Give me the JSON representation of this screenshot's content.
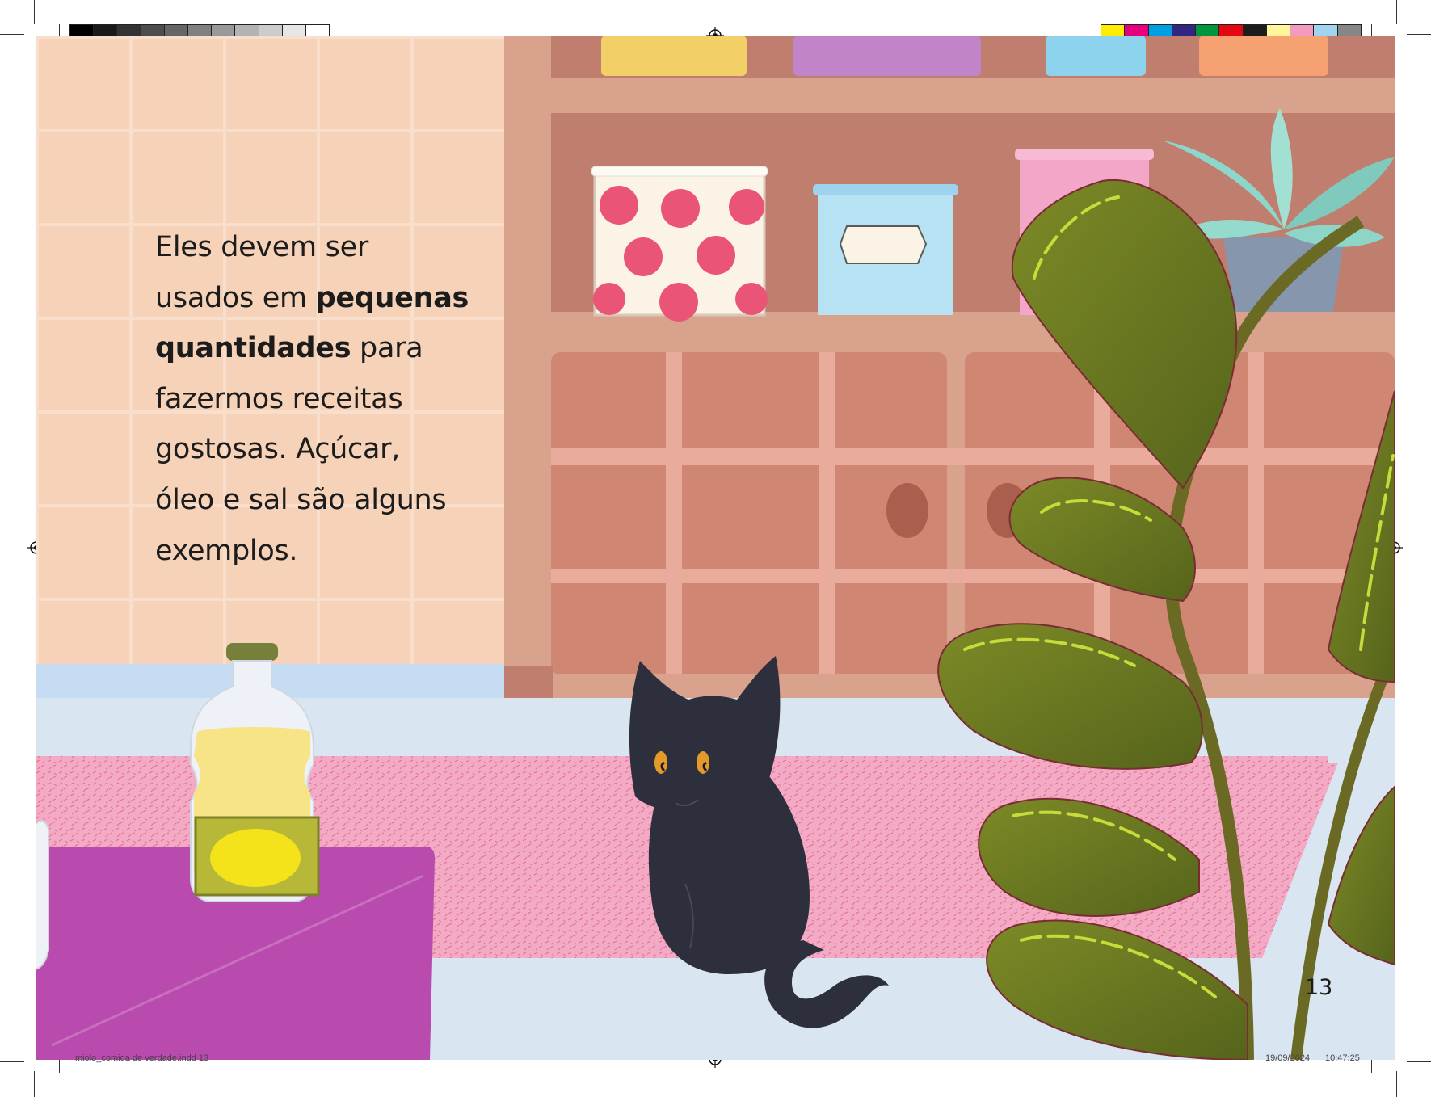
{
  "text": {
    "line1": "Eles devem ser",
    "line2_a": "usados em ",
    "line2_b": "pequenas",
    "line3_a": "quantidades",
    "line3_b": " para",
    "line4": "fazermos receitas",
    "line5": "gostosas. Açúcar,",
    "line6": "óleo e sal são alguns",
    "line7": "exemplos."
  },
  "page_number": "13",
  "slug": {
    "file": "miolo_comida de verdade.indd   13",
    "date": "19/09/2024",
    "time": "10:47:25"
  },
  "colors": {
    "tiles": "#f6d5bd",
    "shelf": "#c27f6e",
    "counter": "#dbe6f2",
    "rug": "#f2a9c3",
    "mat": "#b848ae",
    "cat": "#2e2f3d",
    "cat_eyes": "#e39a2b",
    "leaf": "#6f7d23",
    "leaf_highlight": "#c7dc3b"
  },
  "grayscale_bar": [
    "#000000",
    "#1a1a1a",
    "#333333",
    "#4d4d4d",
    "#666666",
    "#808080",
    "#999999",
    "#b3b3b3",
    "#cccccc",
    "#e6e6e6",
    "#ffffff"
  ],
  "color_bar": [
    "#ffec00",
    "#e6007e",
    "#009fe3",
    "#312783",
    "#009640",
    "#e30613",
    "#1d1d1b",
    "#fff59b",
    "#f49ac1",
    "#9fd5f0",
    "#878787"
  ]
}
